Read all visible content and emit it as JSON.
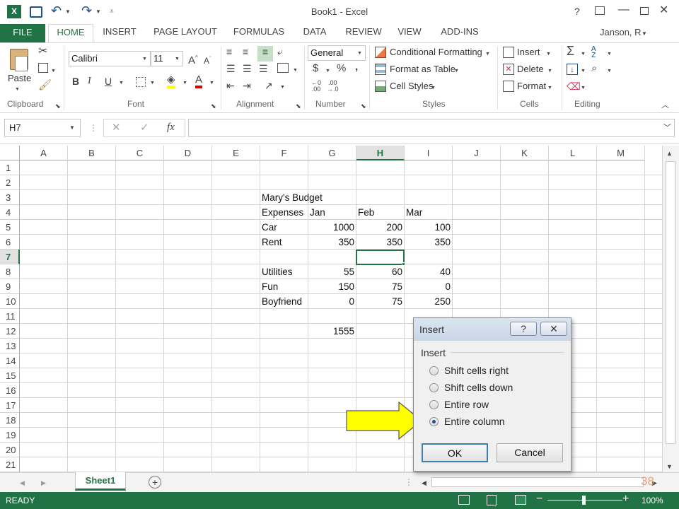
{
  "window": {
    "title": "Book1 - Excel",
    "user": "Janson, R"
  },
  "ribbon_tabs": [
    "FILE",
    "HOME",
    "INSERT",
    "PAGE LAYOUT",
    "FORMULAS",
    "DATA",
    "REVIEW",
    "VIEW",
    "ADD-INS"
  ],
  "clipboard": {
    "paste_label": "Paste",
    "group": "Clipboard"
  },
  "font": {
    "name": "Calibri",
    "size": "11",
    "group": "Font",
    "bold": "B",
    "italic": "I",
    "underline": "U"
  },
  "alignment": {
    "group": "Alignment"
  },
  "number": {
    "format": "General",
    "currency": "$",
    "percent": "%",
    "comma": ",",
    "group": "Number"
  },
  "styles": {
    "conditional": "Conditional Formatting",
    "format_table": "Format as Table",
    "cell_styles": "Cell Styles",
    "group": "Styles"
  },
  "cells": {
    "insert": "Insert",
    "delete": "Delete",
    "format": "Format",
    "group": "Cells"
  },
  "editing": {
    "group": "Editing"
  },
  "formula_bar": {
    "name_box": "H7",
    "fx": "fx",
    "content": ""
  },
  "columns": [
    "A",
    "B",
    "C",
    "D",
    "E",
    "F",
    "G",
    "H",
    "I",
    "J",
    "K",
    "L",
    "M"
  ],
  "rows": [
    "1",
    "2",
    "3",
    "4",
    "5",
    "6",
    "7",
    "8",
    "9",
    "10",
    "11",
    "12",
    "13",
    "14",
    "15",
    "16",
    "17",
    "18",
    "19",
    "20",
    "21"
  ],
  "sheet": {
    "title": "Mary's Budget",
    "expenses_label": "Expenses",
    "months": [
      "Jan",
      "Feb",
      "Mar"
    ],
    "items": [
      {
        "label": "Car",
        "values": [
          "1000",
          "200",
          "100"
        ]
      },
      {
        "label": "Rent",
        "values": [
          "350",
          "350",
          "350"
        ]
      },
      {
        "label": "Utilities",
        "values": [
          "55",
          "60",
          "40"
        ]
      },
      {
        "label": "Fun",
        "values": [
          "150",
          "75",
          "0"
        ]
      },
      {
        "label": "Boyfriend",
        "values": [
          "0",
          "75",
          "250"
        ]
      }
    ],
    "total": "1555"
  },
  "sheet_tab": "Sheet1",
  "slide_number": "38",
  "status": {
    "ready": "READY",
    "zoom": "100%"
  },
  "dialog": {
    "title": "Insert",
    "help": "?",
    "group_label": "Insert",
    "options": [
      "Shift cells right",
      "Shift cells down",
      "Entire row",
      "Entire column"
    ],
    "selected_option": "Entire column",
    "ok": "OK",
    "cancel": "Cancel"
  },
  "colors": {
    "excel_green": "#217346",
    "arrow_yellow": "#ffff00",
    "slide_number": "#f0a070"
  }
}
